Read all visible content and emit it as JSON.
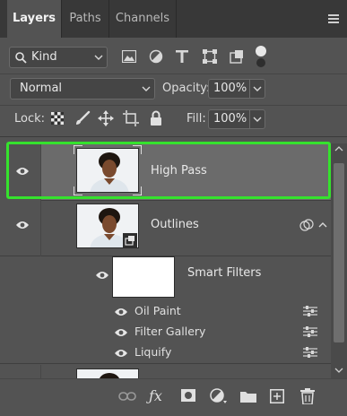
{
  "tabs": [
    {
      "label": "Layers",
      "active": true
    },
    {
      "label": "Paths",
      "active": false
    },
    {
      "label": "Channels",
      "active": false
    }
  ],
  "filter": {
    "kind_label": "Kind"
  },
  "blend": {
    "mode": "Normal",
    "opacity_label": "Opacity:",
    "opacity_value": "100%"
  },
  "lock": {
    "label": "Lock:",
    "fill_label": "Fill:",
    "fill_value": "100%"
  },
  "layers": [
    {
      "name": "High Pass",
      "selected": true,
      "visible": true
    },
    {
      "name": "Outlines",
      "selected": false,
      "visible": true,
      "smart_object": true
    },
    {
      "name": "Smart Filters",
      "filter_mask": true,
      "visible": true
    }
  ],
  "smart_filters": [
    {
      "name": "Oil Paint",
      "visible": true
    },
    {
      "name": "Filter Gallery",
      "visible": true
    },
    {
      "name": "Liquify",
      "visible": true
    }
  ],
  "colors": {
    "panel_bg": "#535353",
    "tabbar_bg": "#383838",
    "selected_row": "#6e6e6e",
    "selection_outline": "#35e22d"
  },
  "icons": [
    "link-layers-icon",
    "fx-icon",
    "add-mask-icon",
    "adjustment-layer-icon",
    "new-group-icon",
    "new-layer-icon",
    "delete-layer-icon"
  ]
}
